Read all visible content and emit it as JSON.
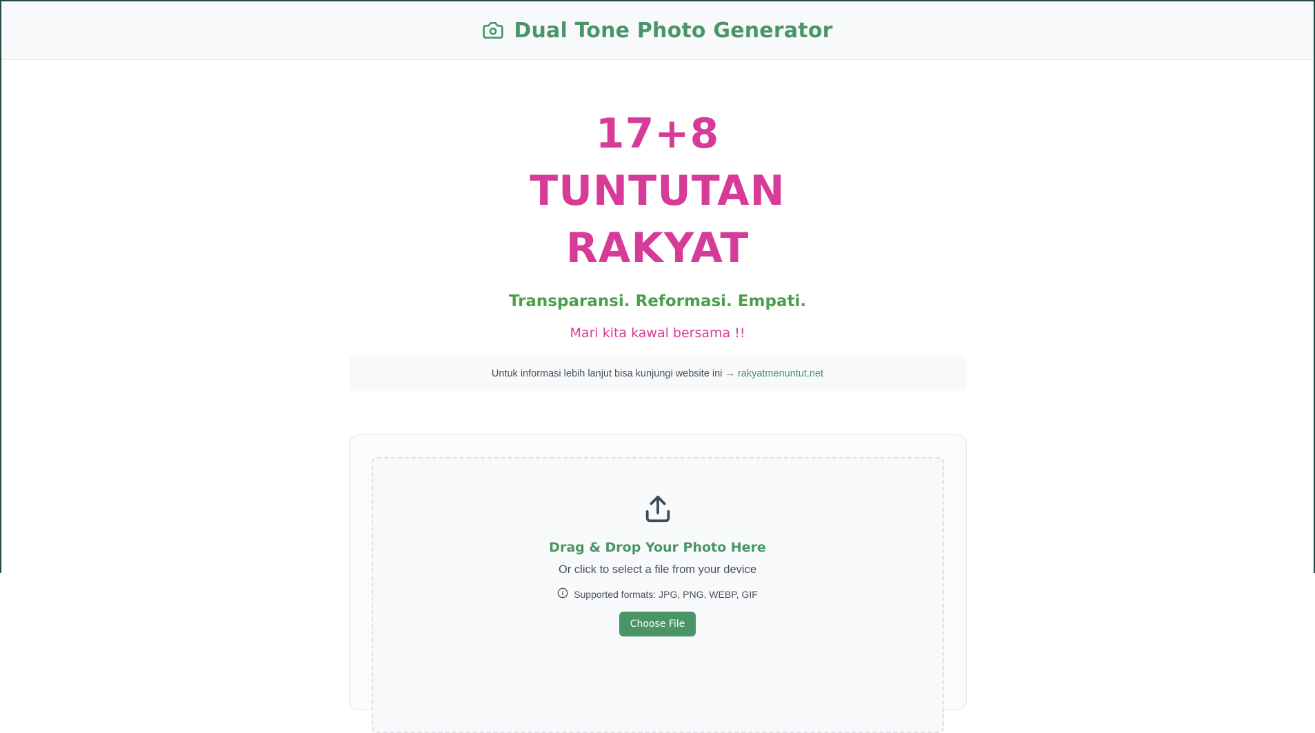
{
  "header": {
    "title": "Dual Tone Photo Generator",
    "icon": "camera-icon"
  },
  "hero": {
    "title": "17+8 TUNTUTAN RAKYAT",
    "tagline": "Transparansi. Reformasi. Empati.",
    "subtitle": "Mari kita kawal bersama !!"
  },
  "info": {
    "text": "Untuk informasi lebih lanjut bisa kunjungi website ini →",
    "link": "rakyatmenuntut.net"
  },
  "upload": {
    "icon": "upload-icon",
    "title": "Drag & Drop Your Photo Here",
    "subtitle": "Or click to select a file from your device",
    "formats": "Supported formats: JPG, PNG, WEBP, GIF",
    "button": "Choose File"
  },
  "colors": {
    "brand_green": "#4a9467",
    "accent_pink": "#d63c97",
    "tagline_green": "#4aa04a"
  }
}
